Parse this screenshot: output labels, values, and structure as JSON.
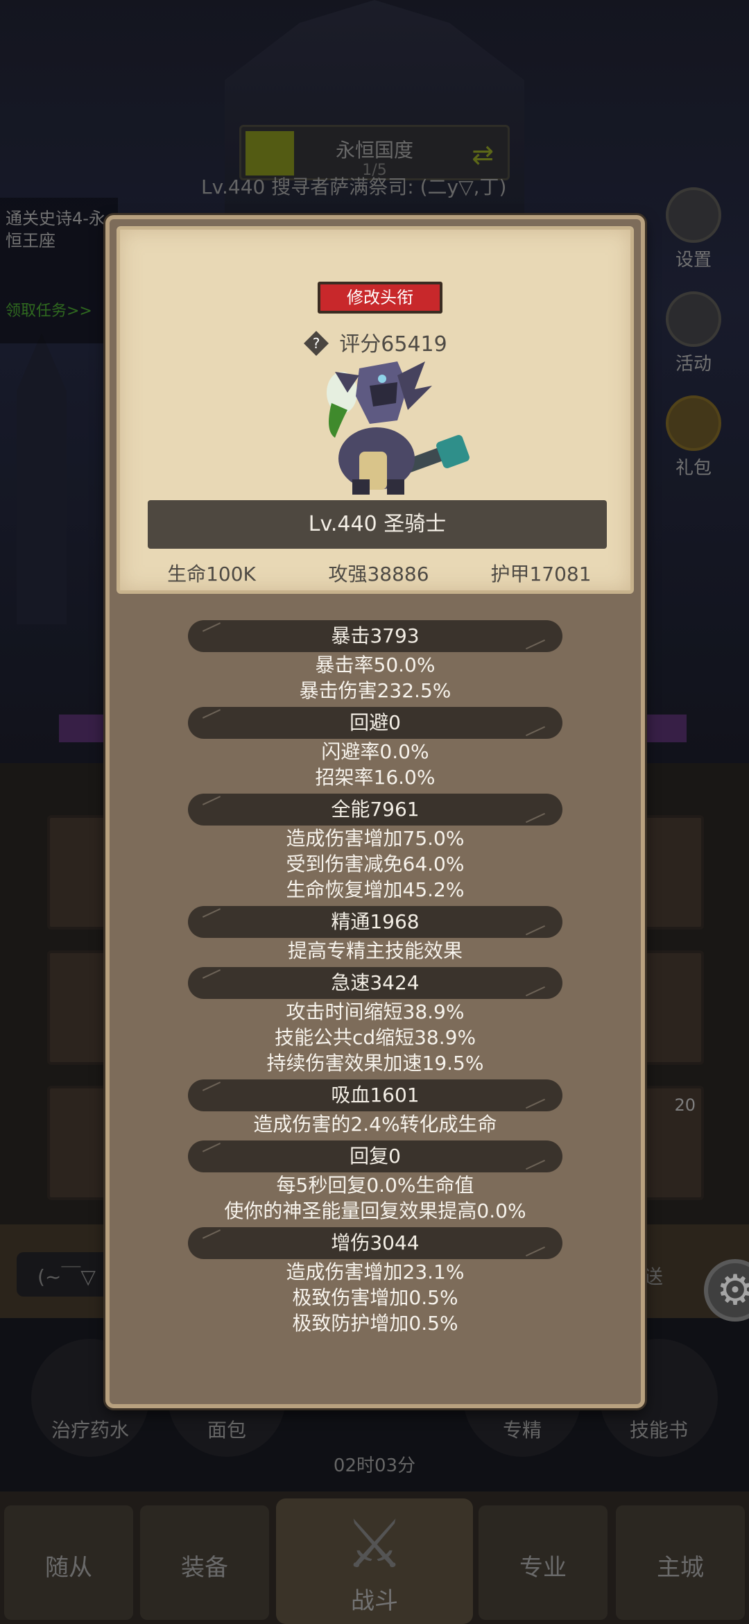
{
  "background": {
    "region_name": "永恒国度",
    "region_page": "1/5",
    "player_line": "Lv.440 搜寻者萨满祭司: (二y▽,丁)",
    "quest_title": "通关史诗4-永恒王座",
    "quest_link": "领取任务>>",
    "side_buttons": [
      "设置",
      "活动",
      "礼包"
    ],
    "slot_badge": "20",
    "chat_placeholder": "(~￣▽",
    "send_label": "发送",
    "items": [
      "治疗药水",
      "面包",
      "专精",
      "技能书"
    ],
    "timer": "02时03分",
    "nav": {
      "followers": "随从",
      "equipment": "装备",
      "battle": "战斗",
      "profession": "专业",
      "main_city": "主城"
    }
  },
  "panel": {
    "edit_title_button": "修改头衔",
    "score": "评分65419",
    "level_class": "Lv.440 圣骑士",
    "base_stats": {
      "hp": "生命100K",
      "attack": "攻强38886",
      "armor": "护甲17081"
    },
    "groups": [
      {
        "header": "暴击3793",
        "lines": [
          "暴击率50.0%",
          "暴击伤害232.5%"
        ]
      },
      {
        "header": "回避0",
        "lines": [
          "闪避率0.0%",
          "招架率16.0%"
        ]
      },
      {
        "header": "全能7961",
        "lines": [
          "造成伤害增加75.0%",
          "受到伤害减免64.0%",
          "生命恢复增加45.2%"
        ]
      },
      {
        "header": "精通1968",
        "lines": [
          "提高专精主技能效果"
        ]
      },
      {
        "header": "急速3424",
        "lines": [
          "攻击时间缩短38.9%",
          "技能公共cd缩短38.9%",
          "持续伤害效果加速19.5%"
        ]
      },
      {
        "header": "吸血1601",
        "lines": [
          "造成伤害的2.4%转化成生命"
        ]
      },
      {
        "header": "回复0",
        "lines": [
          "每5秒回复0.0%生命值",
          "使你的神圣能量回复效果提高0.0%"
        ]
      },
      {
        "header": "增伤3044",
        "lines": [
          "造成伤害增加23.1%",
          "极致伤害增加0.5%",
          "极致防护增加0.5%"
        ]
      }
    ]
  }
}
